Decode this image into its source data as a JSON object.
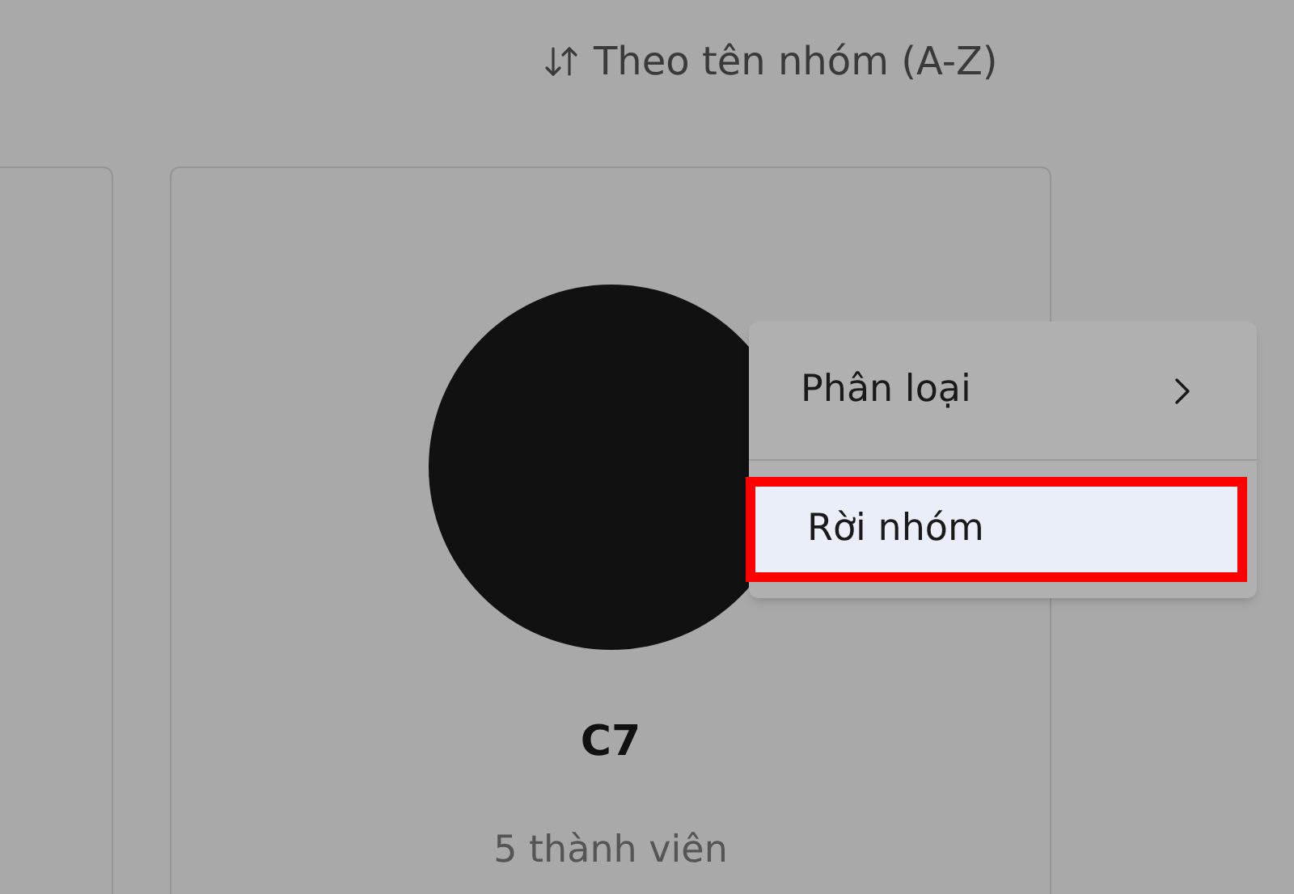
{
  "sort": {
    "label": "Theo tên nhóm (A-Z)"
  },
  "group_card": {
    "name": "C7",
    "members": "5 thành viên"
  },
  "context_menu": {
    "items": [
      {
        "label": "Phân loại",
        "kind": "submenu",
        "selected": false,
        "annotated": false
      },
      {
        "label": "Rời nhóm",
        "kind": "action",
        "selected": true,
        "annotated": true
      }
    ]
  }
}
